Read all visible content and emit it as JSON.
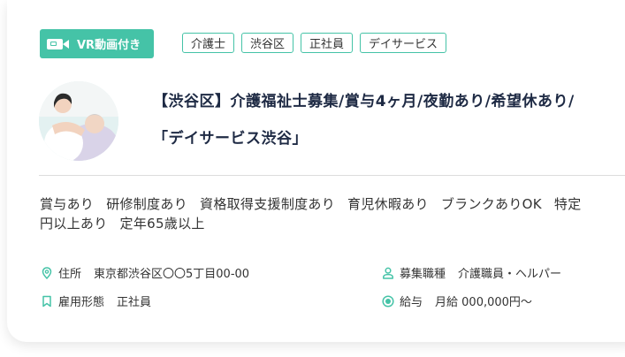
{
  "vr_badge": {
    "label": "VR動画付き"
  },
  "tags": [
    "介護士",
    "渋谷区",
    "正社員",
    "デイサービス"
  ],
  "title": {
    "line1": "【渋谷区】介護福祉士募集/賞与4ヶ月/夜勤あり/希望休あり/",
    "line2": "「デイサービス渋谷」"
  },
  "benefits": [
    "賞与あり",
    "研修制度あり",
    "資格取得支援制度あり",
    "育児休暇あり",
    "ブランクありOK",
    "特定",
    "円以上あり",
    "定年65歳以上"
  ],
  "info": {
    "address": {
      "label": "住所",
      "value": "東京都渋谷区〇〇5丁目00-00"
    },
    "employment": {
      "label": "雇用形態",
      "value": "正社員"
    },
    "job": {
      "label": "募集職種",
      "value": "介護職員・ヘルパー"
    },
    "salary": {
      "label": "給与",
      "value": "月給 000,000円〜"
    }
  },
  "colors": {
    "accent": "#45c3a7",
    "title": "#1e2a44"
  },
  "icons": [
    "video-camera-icon",
    "location-pin-icon",
    "bookmark-icon",
    "person-icon",
    "yen-circle-icon"
  ]
}
